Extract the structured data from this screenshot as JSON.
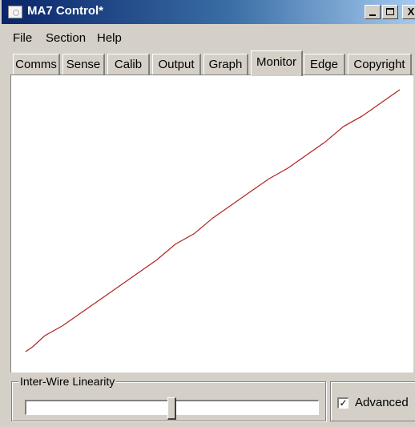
{
  "window": {
    "title": "MA7 Control*",
    "controls": {
      "minimize": "_",
      "maximize": "",
      "close": "X"
    }
  },
  "menu": [
    "File",
    "Section",
    "Help"
  ],
  "tabs": [
    "Comms",
    "Sense",
    "Calib",
    "Output",
    "Graph",
    "Monitor",
    "Edge",
    "Copyright"
  ],
  "active_tab": "Monitor",
  "monitor": {
    "plot_line_color": "#b22222"
  },
  "chart_data": {
    "type": "line",
    "title": "",
    "xlabel": "",
    "ylabel": "",
    "x": [
      0,
      0.02,
      0.05,
      0.1,
      0.15,
      0.2,
      0.25,
      0.3,
      0.35,
      0.4,
      0.45,
      0.5,
      0.55,
      0.6,
      0.65,
      0.7,
      0.75,
      0.8,
      0.85,
      0.9,
      0.95,
      1.0
    ],
    "y": [
      0,
      0.02,
      0.06,
      0.1,
      0.15,
      0.2,
      0.25,
      0.3,
      0.35,
      0.41,
      0.45,
      0.51,
      0.56,
      0.61,
      0.66,
      0.7,
      0.75,
      0.8,
      0.86,
      0.9,
      0.95,
      1.0
    ],
    "xlim": [
      0,
      1
    ],
    "ylim": [
      0,
      1
    ],
    "grid": false
  },
  "bottom": {
    "group_label": "Inter-Wire Linearity",
    "slider_value": 0.5,
    "advanced_label": "Advanced",
    "advanced_checked": true,
    "check_mark": "✓"
  }
}
